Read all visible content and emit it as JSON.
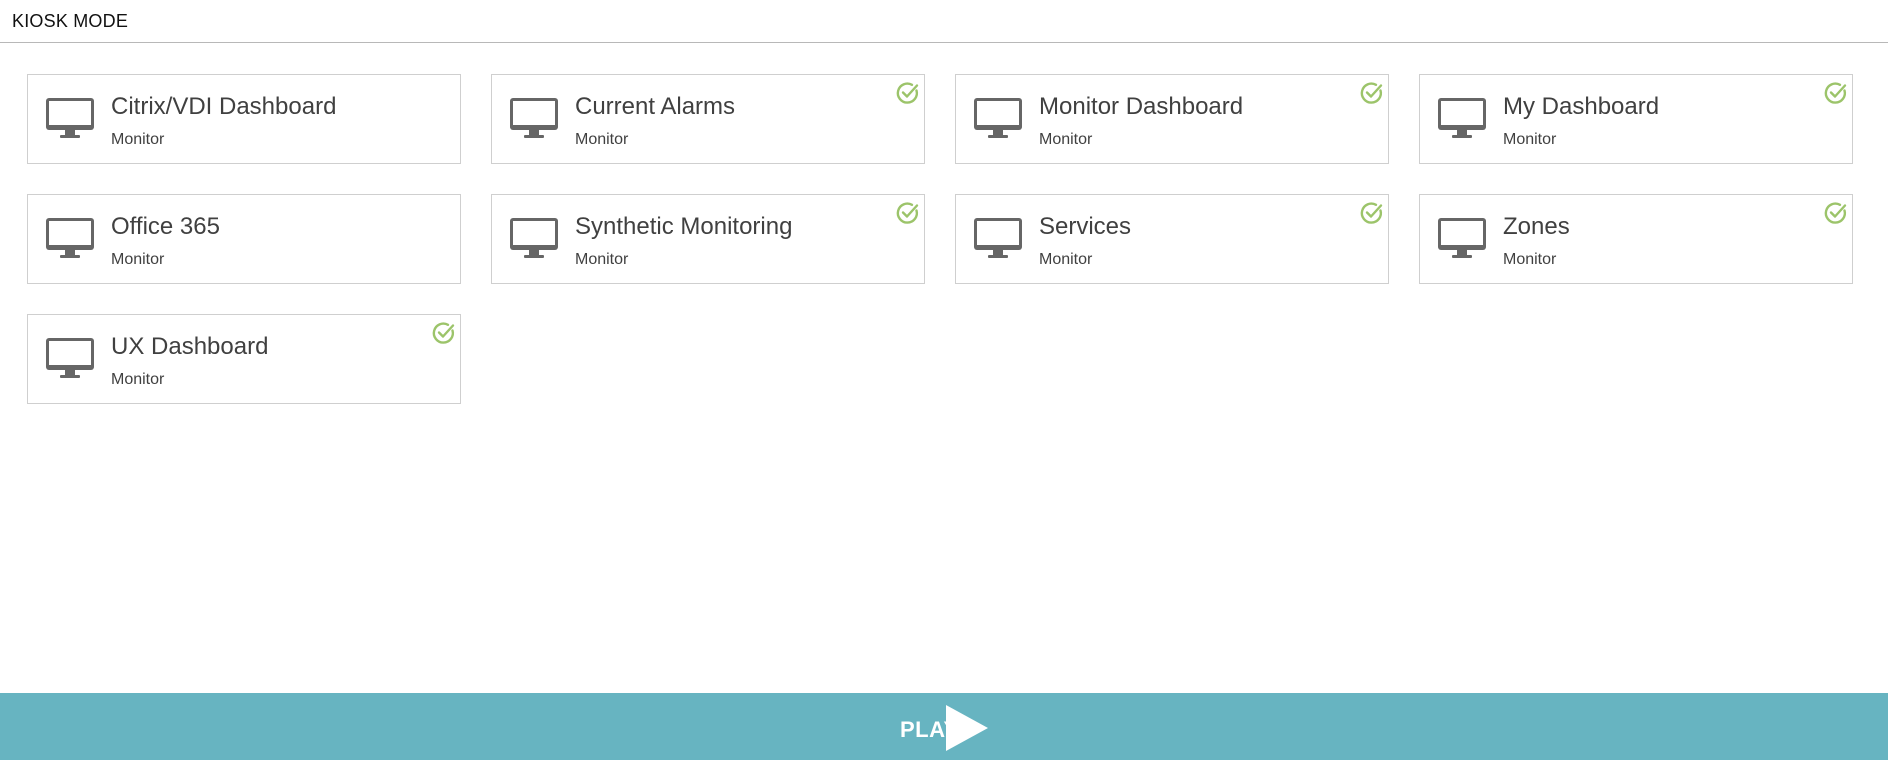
{
  "header": {
    "title": "KIOSK MODE"
  },
  "colors": {
    "accent": "#67b4c1",
    "check": "#9cc46a",
    "icon": "#666666",
    "text": "#404040"
  },
  "dashboards": [
    {
      "title": "Citrix/VDI Dashboard",
      "subtitle": "Monitor",
      "icon": "monitor-icon",
      "checked": false
    },
    {
      "title": "Current Alarms",
      "subtitle": "Monitor",
      "icon": "monitor-icon",
      "checked": true
    },
    {
      "title": "Monitor Dashboard",
      "subtitle": "Monitor",
      "icon": "monitor-icon",
      "checked": true
    },
    {
      "title": "My Dashboard",
      "subtitle": "Monitor",
      "icon": "monitor-icon",
      "checked": true
    },
    {
      "title": "Office 365",
      "subtitle": "Monitor",
      "icon": "monitor-icon",
      "checked": false
    },
    {
      "title": "Synthetic Monitoring",
      "subtitle": "Monitor",
      "icon": "monitor-icon",
      "checked": true
    },
    {
      "title": "Services",
      "subtitle": "Monitor",
      "icon": "monitor-icon",
      "checked": true
    },
    {
      "title": "Zones",
      "subtitle": "Monitor",
      "icon": "monitor-icon",
      "checked": true
    },
    {
      "title": "UX Dashboard",
      "subtitle": "Monitor",
      "icon": "monitor-icon",
      "checked": true
    }
  ],
  "footer": {
    "play_label": "PLAY",
    "play_icon": "play-icon"
  }
}
